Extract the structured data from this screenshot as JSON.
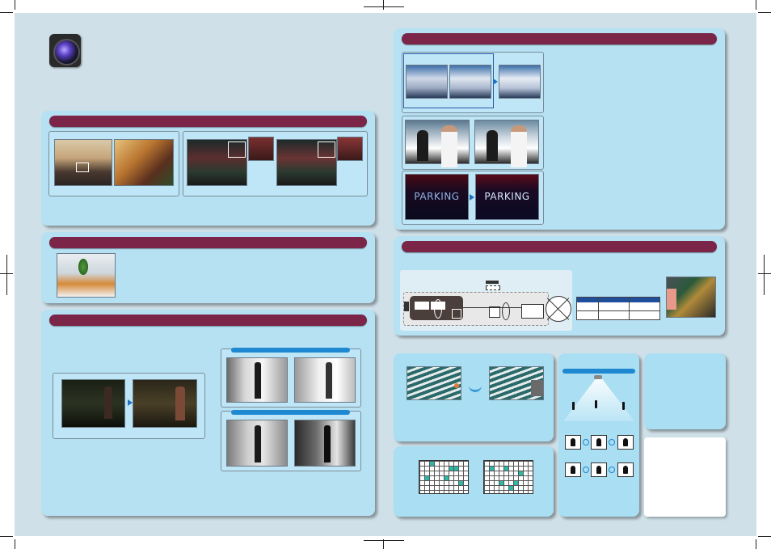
{
  "page": {
    "background": "#cfe0e8",
    "panel_color": "#b6e1f3",
    "section_bar_color": "#7b2548",
    "accent_blue": "#1e88d1"
  },
  "icons": {
    "camera_lens": "camera-lens-icon",
    "arrow": "right-arrow-icon"
  },
  "sections": {
    "top_left": {
      "title": ""
    },
    "mid_left": {
      "title": ""
    },
    "bottom_left": {
      "title": ""
    },
    "top_right": {
      "title": ""
    },
    "mid_right": {
      "title": ""
    }
  },
  "parking_sign": {
    "before": "PARKING",
    "after": "PARKING"
  }
}
